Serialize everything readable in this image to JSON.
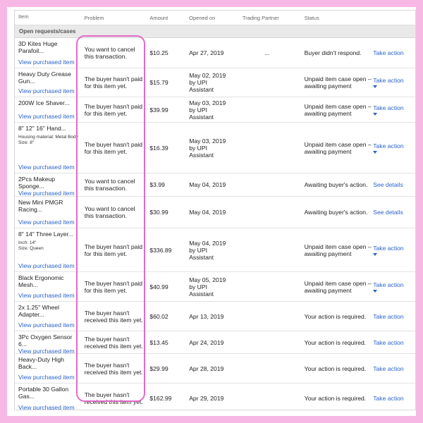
{
  "headers": {
    "item": "Item",
    "problem": "Problem",
    "amount": "Amount",
    "opened_on": "Opened on",
    "trading_partner": "Trading Partner",
    "status": "Status"
  },
  "section_title": "Open requests/cases",
  "link_label": "View purchased item",
  "rows": [
    {
      "title": "3D Kites Huge Parafoil...",
      "attr1": "",
      "attr2": "",
      "problem": "You want to cancel this transaction.",
      "amount": "$10.25",
      "opened": "Apr 27, 2019",
      "partner": "...",
      "status": "Buyer didn't respond.",
      "action": "Take action"
    },
    {
      "title": "Heavy Duty Grease Gun...",
      "attr1": "",
      "attr2": "",
      "problem": "The buyer hasn't paid for this item yet.",
      "amount": "$15.79",
      "opened": "May 02, 2019 by UPI Assistant",
      "partner": "",
      "status": "Unpaid item case open – awaiting payment",
      "action": "Take action"
    },
    {
      "title": "200W Ice Shaver...",
      "attr1": "",
      "attr2": "",
      "problem": "The buyer hasn't paid for this item yet.",
      "amount": "$39.99",
      "opened": "May 03, 2019 by UPI Assistant",
      "partner": "",
      "status": "Unpaid item case open – awaiting payment",
      "action": "Take action"
    },
    {
      "title": "8\" 12\" 16\" Hand...",
      "attr1": "Housing material: Metal Body",
      "attr2": "Size: 8\"",
      "problem": "The buyer hasn't paid for this item yet.",
      "amount": "$16.39",
      "opened": "May 03, 2019 by UPI Assistant",
      "partner": "",
      "status": "Unpaid item case open – awaiting payment",
      "action": "Take action"
    },
    {
      "title": "2Pcs Makeup Sponge...",
      "attr1": "",
      "attr2": "",
      "problem": "You want to cancel this transaction.",
      "amount": "$3.99",
      "opened": "May 04, 2019",
      "partner": "",
      "status": "Awaiting buyer's action.",
      "action": "See details"
    },
    {
      "title": "New Mini PMGR Racing...",
      "attr1": "",
      "attr2": "",
      "problem": "You want to cancel this transaction.",
      "amount": "$30.99",
      "opened": "May 04, 2019",
      "partner": "",
      "status": "Awaiting buyer's action.",
      "action": "See details"
    },
    {
      "title": "8\" 14\" Three Layer...",
      "attr1": "Inch: 14\"",
      "attr2": "Size: Queen",
      "problem": "The buyer hasn't paid for this item yet.",
      "amount": "$336.89",
      "opened": "May 04, 2019 by UPI Assistant",
      "partner": "",
      "status": "Unpaid item case open – awaiting payment",
      "action": "Take action"
    },
    {
      "title": "Black Ergonomic Mesh...",
      "attr1": "",
      "attr2": "",
      "problem": "The buyer hasn't paid for this item yet.",
      "amount": "$40.99",
      "opened": "May 05, 2019 by UPI Assistant",
      "partner": "",
      "status": "Unpaid item case open – awaiting payment",
      "action": "Take action"
    },
    {
      "title": "2x 1.25\" Wheel Adapter...",
      "attr1": "",
      "attr2": "",
      "problem": "The buyer hasn't received this item yet.",
      "amount": "$60.02",
      "opened": "Apr 13, 2019",
      "partner": "",
      "status": "Your action is required.",
      "action": "Take action"
    },
    {
      "title": "3Pc Oxygen Sensor 6...",
      "attr1": "",
      "attr2": "",
      "problem": "The buyer hasn't received this item yet.",
      "amount": "$13.45",
      "opened": "Apr 24, 2019",
      "partner": "",
      "status": "Your action is required.",
      "action": "Take action"
    },
    {
      "title": "Heavy-Duty High Back...",
      "attr1": "",
      "attr2": "",
      "problem": "The buyer hasn't received this item yet.",
      "amount": "$29.99",
      "opened": "Apr 28, 2019",
      "partner": "",
      "status": "Your action is required.",
      "action": "Take action"
    },
    {
      "title": "Portable 30 Gallon Gas...",
      "attr1": "",
      "attr2": "",
      "problem": "The buyer hasn't received this item yet.",
      "amount": "$162.99",
      "opened": "Apr 29, 2019",
      "partner": "",
      "status": "Your action is required.",
      "action": "Take action"
    }
  ],
  "colors": {
    "background": "#f7b8e6",
    "highlight": "#e46ac8",
    "link": "#2a63c8",
    "section_bg": "#e9e9e9"
  }
}
